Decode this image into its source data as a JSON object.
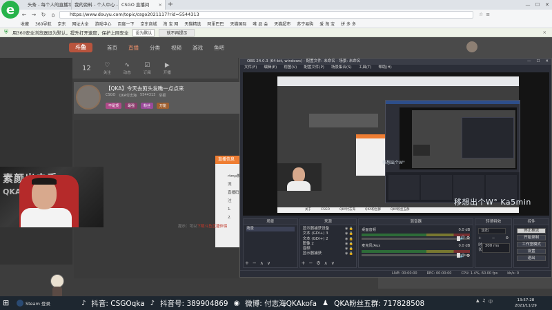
{
  "browser": {
    "logo": "e",
    "tabs": [
      {
        "label": "头条 - 每个人的直播平台",
        "active": false
      },
      {
        "label": "我的资料 - 个人中心 - 斗鱼",
        "active": false
      },
      {
        "label": "CSGO 直播间",
        "active": true
      }
    ],
    "url": "https://www.douyu.com/topic/csgo2021117?rid=5544313",
    "notice": {
      "text": "用360安全浏览器设为默认，提升打开速度，保护上网安全",
      "set_label": "设为默认",
      "no_more_label": "就不再提示"
    },
    "bookmarks": [
      "收藏",
      "360导航",
      "京东",
      "网址大全",
      "游戏中心",
      "百度一下",
      "京东商城",
      "淘 宝 网",
      "天猫精选",
      "阿里巴巴",
      "天猫国际",
      "唯 品 会",
      "天猫超市",
      "苏宁易购",
      "爱 淘 宝",
      "拼 多 多"
    ]
  },
  "douyu": {
    "logo": "斗鱼",
    "nav": [
      "首页",
      "直播",
      "分类",
      "视频",
      "游戏",
      "鱼吧"
    ],
    "toolbar": {
      "count": "12",
      "items": [
        "关注",
        "动态",
        "订阅",
        "开播"
      ]
    },
    "room": {
      "title": "【QKA】今天去剪头发瞧一点点来",
      "meta": [
        "CSGO",
        "QKA付志海",
        "5544313",
        "举报"
      ],
      "tags": [
        "不是顶",
        "最强",
        "粉丝",
        "万能"
      ]
    },
    "popup": {
      "title": "直播信息",
      "lines": [
        "rtmp推流",
        "直播码",
        "注",
        "1.",
        "2."
      ]
    },
    "bottom_text": "提示：可以",
    "bottom_text_red": "下载斗鱼直播伴侣"
  },
  "webcam": {
    "overlay_text": "素颜出击手",
    "overlay_text2": "QKA"
  },
  "obs": {
    "title": "OBS 24.0.3 (64-bit, windows) - 配置文件: 未命名 - 场景: 未命名",
    "menu": [
      "文件(F)",
      "编辑(E)",
      "视图(V)",
      "配置文件(P)",
      "场景集合(S)",
      "工具(T)",
      "帮助(H)"
    ],
    "capture": {
      "overlay_text": "移想出个W°",
      "overlay_text_big": "移想出个W°   Ka5min",
      "bar": [
        "关于",
        "CSGO",
        "QKA付志海",
        "QKA粉丝群",
        "QKA粉丝五群"
      ]
    },
    "docks": {
      "scenes": {
        "title": "场景",
        "items": [
          "场景"
        ]
      },
      "sources": {
        "title": "来源",
        "items": [
          "显示器捕获设备",
          "文本 (GDI+) 3",
          "文本 (GDI+) 2",
          "图像 2",
          "音频",
          "显示器捕获"
        ]
      },
      "mixer": {
        "title": "混音器",
        "channels": [
          {
            "name": "桌面音频",
            "level": "0.0 dB"
          },
          {
            "name": "麦克风/Aux",
            "level": "0.0 dB"
          }
        ]
      },
      "transitions": {
        "title": "转场特效",
        "type": "淡出",
        "duration_label": "时长",
        "duration": "300 ms"
      },
      "controls": {
        "title": "控件",
        "buttons": [
          "停止推流",
          "开始录制",
          "工作室模式",
          "设置",
          "退出"
        ]
      }
    },
    "status": [
      "LIVE: 00:00:00",
      "REC: 00:00:00",
      "CPU: 1.4%, 60.00 fps",
      "kb/s: 0"
    ]
  },
  "taskbar": {
    "steam_label": "Steam 登录",
    "ticker": [
      {
        "icon": "tiktok-icon",
        "text": "抖音: CSGOqka"
      },
      {
        "icon": "tiktok-icon",
        "text": "抖音号: 389904869"
      },
      {
        "icon": "weibo-icon",
        "text": "微博: 付志海QKAkofa"
      },
      {
        "icon": "group-icon",
        "text": "QKA粉丝五群: 717828508"
      }
    ],
    "clock_time": "13:57:28",
    "clock_date": "2021/11/29"
  },
  "colors": {
    "accent": "#ef7d32",
    "obs_bg": "#2b2e38",
    "taskbar": "#1e2730"
  }
}
